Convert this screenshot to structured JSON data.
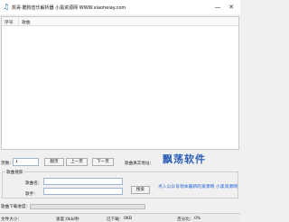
{
  "window": {
    "title": "凯哥·酷狗音乐解析器    小黑资源网 WWW.xiaoheiay.com",
    "minimize_glyph": "—",
    "close_glyph": "✕"
  },
  "list": {
    "columns": [
      "序号",
      "歌曲"
    ]
  },
  "paging": {
    "page_label": "页数：",
    "page_value": "1",
    "jump_label": "翻页",
    "prev_label": "上一页",
    "next_label": "下一页",
    "real_address_label": "歌曲真实地址："
  },
  "search": {
    "group_title": "歌曲搜索",
    "song_label": "歌曲名：",
    "song_value": "",
    "singer_label": "歌手：",
    "singer_value": "",
    "search_button": "搜索",
    "join_link": "点入公众号领本最新的资源网",
    "site_link": "小黑资源网"
  },
  "watermark": {
    "text": "飘荡软件"
  },
  "download": {
    "progress_label": "歌曲下载进度：",
    "progress": 0
  },
  "status": {
    "file_size_label": "文件大小：",
    "speed_label": "速度：",
    "speed_value": "0kb/秒",
    "downloaded_label": "已下载：",
    "downloaded_value": "0KB",
    "percent_label": "百分比：",
    "percent_value": "0%"
  }
}
